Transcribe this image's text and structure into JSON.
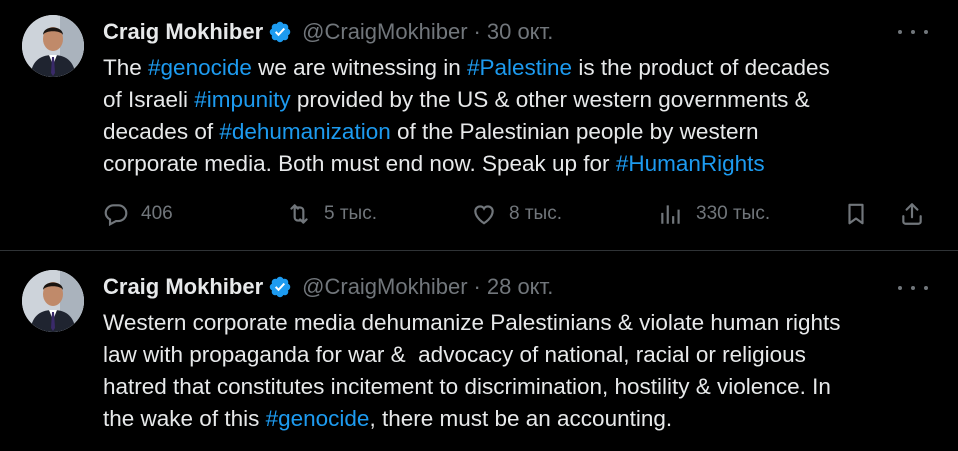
{
  "colors": {
    "background": "#000000",
    "text": "#e7e9ea",
    "muted": "#71767b",
    "link": "#1d9bf0",
    "verified": "#1d9bf0",
    "divider": "#2f3336"
  },
  "tweets": [
    {
      "author": {
        "name": "Craig Mokhiber",
        "handle": "@CraigMokhiber",
        "verified": true
      },
      "separator": "·",
      "date": "30 окт.",
      "lines": [
        [
          "The ",
          "#genocide",
          " we are witnessing in ",
          "#Palestine",
          " is the product of decades"
        ],
        [
          "of Israeli ",
          "#impunity",
          " provided by the US & other western governments &"
        ],
        [
          "decades of ",
          "#dehumanization",
          " of the Palestinian people by western"
        ],
        [
          "corporate media. Both must end now. Speak up for ",
          "#HumanRights"
        ]
      ],
      "actions": {
        "replies": "406",
        "reposts": "5 тыс.",
        "likes": "8 тыс.",
        "views": "330 тыс."
      },
      "icons": [
        "reply-icon",
        "repost-icon",
        "like-icon",
        "views-icon",
        "bookmark-icon",
        "share-icon",
        "more-icon",
        "verified-badge-icon"
      ]
    },
    {
      "author": {
        "name": "Craig Mokhiber",
        "handle": "@CraigMokhiber",
        "verified": true
      },
      "separator": "·",
      "date": "28 окт.",
      "lines": [
        [
          "Western corporate media dehumanize Palestinians & violate human rights"
        ],
        [
          "law with propaganda for war &  advocacy of national, racial or religious"
        ],
        [
          "hatred that constitutes incitement to discrimination, hostility & violence. In"
        ],
        [
          "the wake of this ",
          "#genocide",
          ", there must be an accounting."
        ]
      ]
    }
  ]
}
